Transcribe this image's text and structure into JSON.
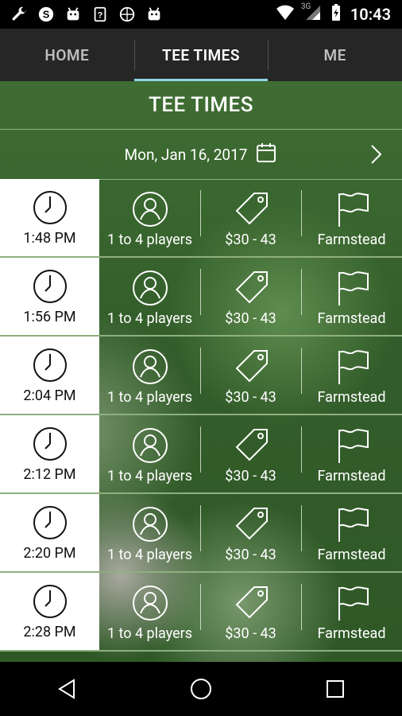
{
  "statusbar": {
    "time": "10:43",
    "icons": [
      "wrench-icon",
      "skype-icon",
      "android-icon",
      "help-icon",
      "basketball-icon",
      "android-icon"
    ],
    "network": "3G"
  },
  "tabs": [
    {
      "label": "HOME",
      "active": false
    },
    {
      "label": "TEE TIMES",
      "active": true
    },
    {
      "label": "ME",
      "active": false
    }
  ],
  "page": {
    "title": "TEE TIMES",
    "date": "Mon, Jan 16, 2017"
  },
  "rows": [
    {
      "time": "1:48 PM",
      "players": "1 to 4 players",
      "price": "$30 - 43",
      "course": "Farmstead"
    },
    {
      "time": "1:56 PM",
      "players": "1 to 4 players",
      "price": "$30 - 43",
      "course": "Farmstead"
    },
    {
      "time": "2:04 PM",
      "players": "1 to 4 players",
      "price": "$30 - 43",
      "course": "Farmstead"
    },
    {
      "time": "2:12 PM",
      "players": "1 to 4 players",
      "price": "$30 - 43",
      "course": "Farmstead"
    },
    {
      "time": "2:20 PM",
      "players": "1 to 4 players",
      "price": "$30 - 43",
      "course": "Farmstead"
    },
    {
      "time": "2:28 PM",
      "players": "1 to 4 players",
      "price": "$30 - 43",
      "course": "Farmstead"
    }
  ],
  "colors": {
    "accent": "#8fd6e6",
    "green_background": "#335d2a",
    "tab_background": "#262626"
  }
}
